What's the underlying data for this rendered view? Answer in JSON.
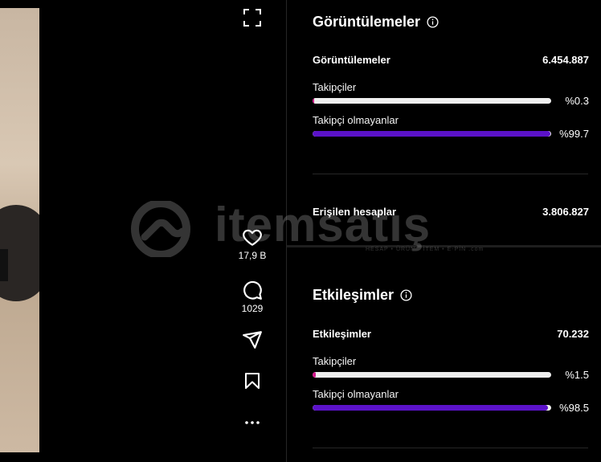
{
  "media": {
    "likes_count": "17,9 B",
    "comments_count": "1029"
  },
  "watermark": {
    "brand": "itemsatış",
    "tagline": "HESAP • ÜRÜN • İTEM • E-PİN .com"
  },
  "views_section": {
    "title": "Görüntülemeler",
    "metric_label": "Görüntülemeler",
    "metric_value": "6.454.887",
    "followers": {
      "label": "Takipçiler",
      "percent_text": "%0.3",
      "percent": 0.3
    },
    "non_followers": {
      "label": "Takipçi olmayanlar",
      "percent_text": "%99.7",
      "percent": 99.7
    },
    "reach_label": "Erişilen hesaplar",
    "reach_value": "3.806.827"
  },
  "engagement_section": {
    "title": "Etkileşimler",
    "metric_label": "Etkileşimler",
    "metric_value": "70.232",
    "followers": {
      "label": "Takipçiler",
      "percent_text": "%1.5",
      "percent": 1.5
    },
    "non_followers": {
      "label": "Takipçi olmayanlar",
      "percent_text": "%98.5",
      "percent": 98.5
    }
  },
  "colors": {
    "background": "#000000",
    "follower_bar": "#d3188c",
    "non_follower_bar": "#5b12c9",
    "track": "#efefef"
  },
  "icons": [
    "expand-icon",
    "heart-icon",
    "comment-icon",
    "share-icon",
    "bookmark-icon",
    "more-icon",
    "info-icon"
  ]
}
